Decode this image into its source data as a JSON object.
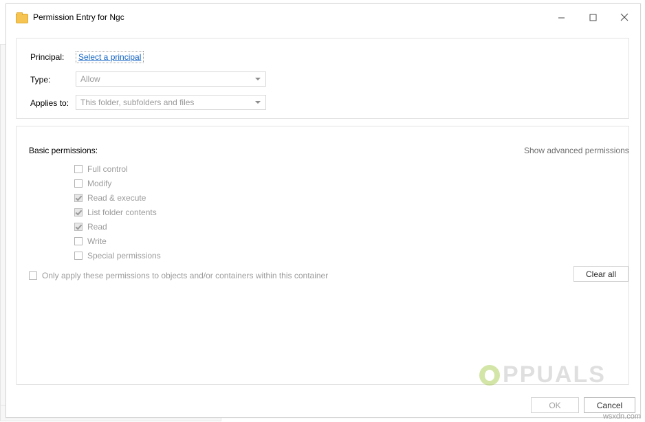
{
  "window": {
    "title": "Permission Entry for Ngc",
    "icon": "folder-icon",
    "minimize": "─",
    "maximize": "☐",
    "close": "✕"
  },
  "top_section": {
    "principal_label": "Principal:",
    "principal_link": "Select a principal",
    "type_label": "Type:",
    "type_value": "Allow",
    "applies_to_label": "Applies to:",
    "applies_to_value": "This folder, subfolders and files"
  },
  "permissions": {
    "section_label": "Basic permissions:",
    "advanced_link": "Show advanced permissions",
    "items": [
      {
        "label": "Full control",
        "checked": false
      },
      {
        "label": "Modify",
        "checked": false
      },
      {
        "label": "Read & execute",
        "checked": true
      },
      {
        "label": "List folder contents",
        "checked": true
      },
      {
        "label": "Read",
        "checked": true
      },
      {
        "label": "Write",
        "checked": false
      },
      {
        "label": "Special permissions",
        "checked": false
      }
    ],
    "only_apply_label": "Only apply these permissions to objects and/or containers within this container",
    "only_apply_checked": false,
    "clear_all_label": "Clear all"
  },
  "footer": {
    "ok_label": "OK",
    "cancel_label": "Cancel"
  },
  "watermark": {
    "brand": "PPUALS",
    "corner": "wsxdn.com"
  },
  "background": {
    "ghost_text": "... ... ..... ........ .. ... ..."
  },
  "colors": {
    "link": "#1364c4",
    "disabled_text": "#9b9b9b",
    "border": "#e2e2e2",
    "folder": "#f6c453",
    "watermark_green": "#9fc83f"
  }
}
